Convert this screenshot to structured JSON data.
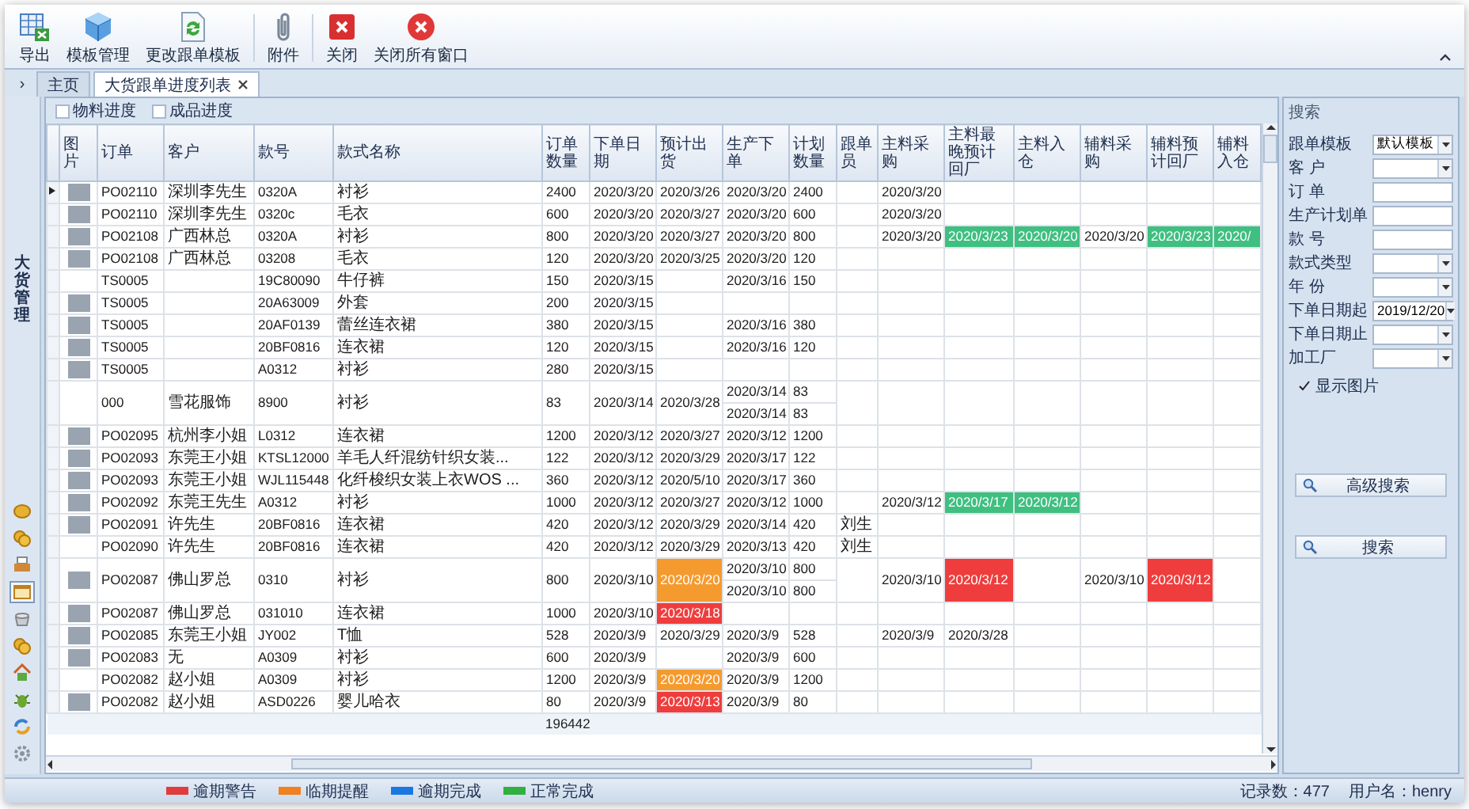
{
  "toolbar": [
    {
      "label": "导出"
    },
    {
      "label": "模板管理"
    },
    {
      "label": "更改跟单模板"
    },
    {
      "label": "附件"
    },
    {
      "label": "关闭"
    },
    {
      "label": "关闭所有窗口"
    }
  ],
  "tabs": {
    "toggle": "›",
    "items": [
      {
        "label": "主页",
        "selected": false,
        "closable": false
      },
      {
        "label": "大货跟单进度列表",
        "selected": true,
        "closable": true
      }
    ]
  },
  "sidebar": {
    "title": "大货管理",
    "icons": [
      {
        "kind": "coin",
        "selected": false
      },
      {
        "kind": "coins",
        "selected": false
      },
      {
        "kind": "printer",
        "selected": false
      },
      {
        "kind": "window",
        "selected": true
      },
      {
        "kind": "pot",
        "selected": false
      },
      {
        "kind": "coins",
        "selected": false
      },
      {
        "kind": "house",
        "selected": false
      },
      {
        "kind": "bug",
        "selected": false
      },
      {
        "kind": "sync",
        "selected": false
      },
      {
        "kind": "gear",
        "selected": false
      }
    ]
  },
  "view_options": [
    {
      "label": "物料进度",
      "checked": false
    },
    {
      "label": "成品进度",
      "checked": false
    }
  ],
  "table": {
    "columns": [
      {
        "label": "图片",
        "kind": "photo"
      },
      {
        "label": "订单",
        "kind": "code"
      },
      {
        "label": "客户",
        "kind": "text"
      },
      {
        "label": "款号",
        "kind": "code"
      },
      {
        "label": "款式名称",
        "kind": "wide"
      },
      {
        "label": "订单数量",
        "kind": "qty"
      },
      {
        "label": "下单日期",
        "kind": "date"
      },
      {
        "label": "预计出货",
        "kind": "date"
      },
      {
        "label": "生产下单",
        "kind": "date"
      },
      {
        "label": "计划数量",
        "kind": "qty"
      },
      {
        "label": "跟单员",
        "kind": "person"
      },
      {
        "label": "主料采购",
        "kind": "date"
      },
      {
        "label": "主料最晚预计回厂",
        "kind": "longdate"
      },
      {
        "label": "主料入仓",
        "kind": "date"
      },
      {
        "label": "辅料采购",
        "kind": "date"
      },
      {
        "label": "辅料预计回厂",
        "kind": "date"
      },
      {
        "label": "辅料入仓",
        "kind": "cut"
      }
    ],
    "rows": [
      {
        "selected": true,
        "cells": [
          {
            "photo": true
          },
          "PO02110",
          "深圳李先生",
          "0320A",
          "衬衫",
          "2400",
          "2020/3/20",
          "2020/3/26",
          "2020/3/20",
          "2400",
          "",
          "2020/3/20",
          "",
          "",
          "",
          "",
          ""
        ]
      },
      {
        "selected": false,
        "cells": [
          {
            "photo": true
          },
          "PO02110",
          "深圳李先生",
          "0320c",
          "毛衣",
          "600",
          "2020/3/20",
          "2020/3/27",
          "2020/3/20",
          "600",
          "",
          "2020/3/20",
          "",
          "",
          "",
          "",
          ""
        ]
      },
      {
        "selected": false,
        "cells": [
          {
            "photo": true
          },
          "PO02108",
          "广西林总",
          "0320A",
          "衬衫",
          "800",
          "2020/3/20",
          "2020/3/27",
          "2020/3/20",
          "800",
          "",
          "2020/3/20",
          {
            "text": "2020/3/23",
            "color": "#3fbf80"
          },
          {
            "text": "2020/3/20",
            "color": "#3fbf80"
          },
          "2020/3/20",
          {
            "text": "2020/3/23",
            "color": "#3fbf80"
          },
          {
            "text": "2020/",
            "color": "#3fbf80"
          }
        ]
      },
      {
        "selected": false,
        "cells": [
          {
            "photo": true
          },
          "PO02108",
          "广西林总",
          "03208",
          "毛衣",
          "120",
          "2020/3/20",
          "2020/3/25",
          "2020/3/20",
          "120",
          "",
          "",
          "",
          "",
          "",
          "",
          ""
        ]
      },
      {
        "selected": false,
        "cells": [
          {
            "photo": false
          },
          "TS0005",
          "",
          "19C80090",
          "牛仔裤",
          "150",
          "2020/3/15",
          "",
          "2020/3/16",
          "150",
          "",
          "",
          "",
          "",
          "",
          "",
          ""
        ]
      },
      {
        "selected": false,
        "cells": [
          {
            "photo": true
          },
          "TS0005",
          "",
          "20A63009",
          "外套",
          "200",
          "2020/3/15",
          "",
          "",
          "",
          "",
          "",
          "",
          "",
          "",
          "",
          ""
        ]
      },
      {
        "selected": false,
        "cells": [
          {
            "photo": true
          },
          "TS0005",
          "",
          "20AF0139",
          "蕾丝连衣裙",
          "380",
          "2020/3/15",
          "",
          "2020/3/16",
          "380",
          "",
          "",
          "",
          "",
          "",
          "",
          ""
        ]
      },
      {
        "selected": false,
        "cells": [
          {
            "photo": true
          },
          "TS0005",
          "",
          "20BF0816",
          "连衣裙",
          "120",
          "2020/3/15",
          "",
          "2020/3/16",
          "120",
          "",
          "",
          "",
          "",
          "",
          "",
          ""
        ]
      },
      {
        "selected": false,
        "cells": [
          {
            "photo": true
          },
          "TS0005",
          "",
          "A0312",
          "衬衫",
          "280",
          "2020/3/15",
          "",
          "",
          "",
          "",
          "",
          "",
          "",
          "",
          "",
          ""
        ]
      },
      {
        "selected": false,
        "cells": [
          {
            "photo": false
          },
          "000",
          "雪花服饰",
          "8900",
          "衬衫",
          "83",
          "2020/3/14",
          "2020/3/28",
          [
            "2020/3/14",
            "2020/3/14"
          ],
          [
            "83",
            "83"
          ],
          "",
          "",
          "",
          "",
          "",
          "",
          ""
        ]
      },
      {
        "selected": false,
        "cells": [
          {
            "photo": true
          },
          "PO02095",
          "杭州李小姐",
          "L0312",
          "连衣裙",
          "1200",
          "2020/3/12",
          "2020/3/27",
          "2020/3/12",
          "1200",
          "",
          "",
          "",
          "",
          "",
          "",
          ""
        ]
      },
      {
        "selected": false,
        "cells": [
          {
            "photo": true
          },
          "PO02093",
          "东莞王小姐",
          "KTSL12000",
          "羊毛人纤混纺针织女装...",
          "122",
          "2020/3/12",
          "2020/3/29",
          "2020/3/17",
          "122",
          "",
          "",
          "",
          "",
          "",
          "",
          ""
        ]
      },
      {
        "selected": false,
        "cells": [
          {
            "photo": true
          },
          "PO02093",
          "东莞王小姐",
          "WJL115448",
          "化纤梭织女装上衣WOS ...",
          "360",
          "2020/3/12",
          "2020/5/10",
          "2020/3/17",
          "360",
          "",
          "",
          "",
          "",
          "",
          "",
          ""
        ]
      },
      {
        "selected": false,
        "cells": [
          {
            "photo": true
          },
          "PO02092",
          "东莞王先生",
          "A0312",
          "衬衫",
          "1000",
          "2020/3/12",
          "2020/3/27",
          "2020/3/12",
          "1000",
          "",
          "2020/3/12",
          {
            "text": "2020/3/17",
            "color": "#3fbf80"
          },
          {
            "text": "2020/3/12",
            "color": "#3fbf80"
          },
          "",
          "",
          ""
        ]
      },
      {
        "selected": false,
        "cells": [
          {
            "photo": true
          },
          "PO02091",
          "许先生",
          "20BF0816",
          "连衣裙",
          "420",
          "2020/3/12",
          "2020/3/29",
          "2020/3/14",
          "420",
          "刘生",
          "",
          "",
          "",
          "",
          "",
          ""
        ]
      },
      {
        "selected": false,
        "cells": [
          {
            "photo": false
          },
          "PO02090",
          "许先生",
          "20BF0816",
          "连衣裙",
          "420",
          "2020/3/12",
          "2020/3/29",
          "2020/3/13",
          "420",
          "刘生",
          "",
          "",
          "",
          "",
          "",
          ""
        ]
      },
      {
        "selected": false,
        "cells": [
          {
            "photo": true
          },
          "PO02087",
          "佛山罗总",
          "0310",
          "衬衫",
          "800",
          "2020/3/10",
          {
            "text": "2020/3/20",
            "color": "#f59a2e"
          },
          [
            "2020/3/10",
            "2020/3/10"
          ],
          [
            "800",
            "800"
          ],
          "",
          "2020/3/10",
          {
            "text": "2020/3/12",
            "color": "#ef3d3d"
          },
          "",
          "2020/3/10",
          {
            "text": "2020/3/12",
            "color": "#ef3d3d"
          },
          ""
        ]
      },
      {
        "selected": false,
        "cells": [
          {
            "photo": true
          },
          "PO02087",
          "佛山罗总",
          "031010",
          "连衣裙",
          "1000",
          "2020/3/10",
          {
            "text": "2020/3/18",
            "color": "#ef3d3d"
          },
          "",
          "",
          "",
          "",
          "",
          "",
          "",
          "",
          ""
        ]
      },
      {
        "selected": false,
        "cells": [
          {
            "photo": true
          },
          "PO02085",
          "东莞王小姐",
          "JY002",
          "T恤",
          "528",
          "2020/3/9",
          "2020/3/29",
          "2020/3/9",
          "528",
          "",
          "2020/3/9",
          "2020/3/28",
          "",
          "",
          "",
          ""
        ]
      },
      {
        "selected": false,
        "cells": [
          {
            "photo": true
          },
          "PO02083",
          "无",
          "A0309",
          "衬衫",
          "600",
          "2020/3/9",
          "",
          "2020/3/9",
          "600",
          "",
          "",
          "",
          "",
          "",
          "",
          ""
        ]
      },
      {
        "selected": false,
        "cells": [
          {
            "photo": false
          },
          "PO02082",
          "赵小姐",
          "A0309",
          "衬衫",
          "1200",
          "2020/3/9",
          {
            "text": "2020/3/20",
            "color": "#f59a2e"
          },
          "2020/3/9",
          "1200",
          "",
          "",
          "",
          "",
          "",
          "",
          ""
        ]
      },
      {
        "selected": false,
        "cells": [
          {
            "photo": true
          },
          "PO02082",
          "赵小姐",
          "ASD0226",
          "婴儿哈衣",
          "80",
          "2020/3/9",
          {
            "text": "2020/3/13",
            "color": "#ef3d3d"
          },
          "2020/3/9",
          "80",
          "",
          "",
          "",
          "",
          "",
          "",
          ""
        ]
      }
    ],
    "total": "196442"
  },
  "search": {
    "title": "搜索",
    "fields": [
      {
        "label": "跟单模板",
        "kind": "select",
        "value": "默认模板"
      },
      {
        "label": "客 户",
        "kind": "select"
      },
      {
        "label": "订 单",
        "kind": "text"
      },
      {
        "label": "生产计划单",
        "kind": "text"
      },
      {
        "label": "款 号",
        "kind": "text"
      },
      {
        "label": "款式类型",
        "kind": "select"
      },
      {
        "label": "年 份",
        "kind": "select"
      },
      {
        "label": "下单日期起",
        "kind": "select",
        "value": "2019/12/20"
      },
      {
        "label": "下单日期止",
        "kind": "select"
      },
      {
        "label": "加工厂",
        "kind": "select"
      }
    ],
    "show_images": {
      "label": "显示图片",
      "checked": true
    },
    "buttons": [
      "高级搜索",
      "搜索"
    ]
  },
  "legend": [
    {
      "label": "逾期警告",
      "color": "#e03c3c"
    },
    {
      "label": "临期提醒",
      "color": "#f08020"
    },
    {
      "label": "逾期完成",
      "color": "#1a78e0"
    },
    {
      "label": "正常完成",
      "color": "#30b040"
    }
  ],
  "status": {
    "records": "记录数：477",
    "user": "用户名：henry"
  }
}
